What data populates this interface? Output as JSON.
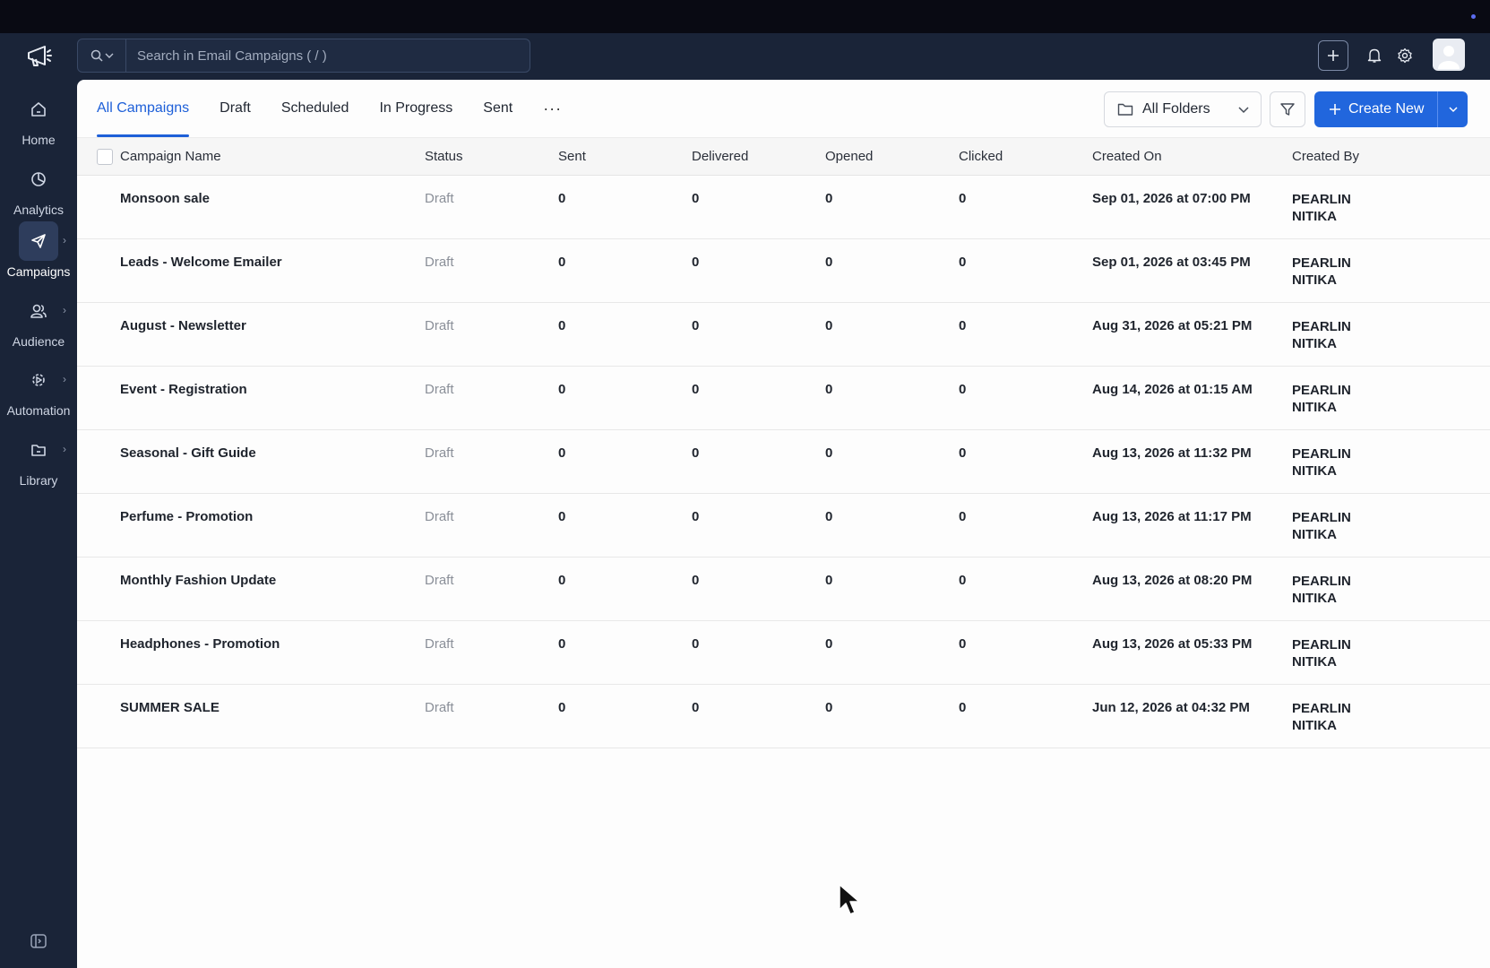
{
  "sidebar": {
    "items": [
      {
        "label": "Home",
        "icon": "home-icon"
      },
      {
        "label": "Analytics",
        "icon": "analytics-icon"
      },
      {
        "label": "Campaigns",
        "icon": "send-icon"
      },
      {
        "label": "Audience",
        "icon": "audience-icon"
      },
      {
        "label": "Automation",
        "icon": "automation-icon"
      },
      {
        "label": "Library",
        "icon": "folder-icon"
      }
    ]
  },
  "search": {
    "placeholder": "Search in Email Campaigns ( / )"
  },
  "tabs": [
    "All Campaigns",
    "Draft",
    "Scheduled",
    "In Progress",
    "Sent"
  ],
  "more_label": "···",
  "folders_label": "All Folders",
  "create_label": "Create New",
  "columns": [
    "Campaign Name",
    "Status",
    "Sent",
    "Delivered",
    "Opened",
    "Clicked",
    "Created On",
    "Created By"
  ],
  "rows": [
    {
      "name": "Monsoon sale",
      "status": "Draft",
      "sent": "0",
      "delivered": "0",
      "opened": "0",
      "clicked": "0",
      "created_on": "Sep 01, 2026 at 07:00 PM",
      "by1": "PEARLIN",
      "by2": "NITIKA"
    },
    {
      "name": "Leads - Welcome Emailer",
      "status": "Draft",
      "sent": "0",
      "delivered": "0",
      "opened": "0",
      "clicked": "0",
      "created_on": "Sep 01, 2026 at 03:45 PM",
      "by1": "PEARLIN",
      "by2": "NITIKA"
    },
    {
      "name": "August - Newsletter",
      "status": "Draft",
      "sent": "0",
      "delivered": "0",
      "opened": "0",
      "clicked": "0",
      "created_on": "Aug 31, 2026 at 05:21 PM",
      "by1": "PEARLIN",
      "by2": "NITIKA"
    },
    {
      "name": "Event - Registration",
      "status": "Draft",
      "sent": "0",
      "delivered": "0",
      "opened": "0",
      "clicked": "0",
      "created_on": "Aug 14, 2026 at 01:15 AM",
      "by1": "PEARLIN",
      "by2": "NITIKA"
    },
    {
      "name": "Seasonal - Gift Guide",
      "status": "Draft",
      "sent": "0",
      "delivered": "0",
      "opened": "0",
      "clicked": "0",
      "created_on": "Aug 13, 2026 at 11:32 PM",
      "by1": "PEARLIN",
      "by2": "NITIKA"
    },
    {
      "name": "Perfume - Promotion",
      "status": "Draft",
      "sent": "0",
      "delivered": "0",
      "opened": "0",
      "clicked": "0",
      "created_on": "Aug 13, 2026 at 11:17 PM",
      "by1": "PEARLIN",
      "by2": "NITIKA"
    },
    {
      "name": "Monthly Fashion Update",
      "status": "Draft",
      "sent": "0",
      "delivered": "0",
      "opened": "0",
      "clicked": "0",
      "created_on": "Aug 13, 2026 at 08:20 PM",
      "by1": "PEARLIN",
      "by2": "NITIKA"
    },
    {
      "name": "Headphones - Promotion",
      "status": "Draft",
      "sent": "0",
      "delivered": "0",
      "opened": "0",
      "clicked": "0",
      "created_on": "Aug 13, 2026 at 05:33 PM",
      "by1": "PEARLIN",
      "by2": "NITIKA"
    },
    {
      "name": "SUMMER SALE",
      "status": "Draft",
      "sent": "0",
      "delivered": "0",
      "opened": "0",
      "clicked": "0",
      "created_on": "Jun 12, 2026 at 04:32 PM",
      "by1": "PEARLIN",
      "by2": "NITIKA"
    }
  ],
  "colors": {
    "accent": "#2166dd",
    "sidebar": "#1a2438",
    "status_text": "#8a8f98"
  }
}
